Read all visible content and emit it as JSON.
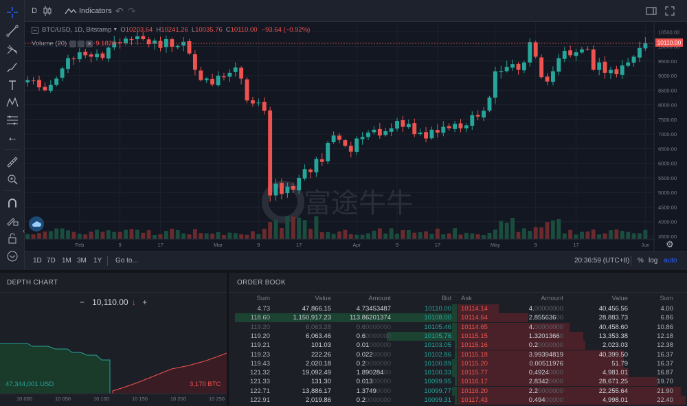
{
  "toolbar": {
    "interval": "D",
    "indicators_label": "Indicators"
  },
  "legend": {
    "symbol": "BTC/USD, 1D, Bitstamp",
    "open_label": "O",
    "open": "10203.64",
    "high_label": "H",
    "high": "10241.26",
    "low_label": "L",
    "low": "10035.76",
    "close_label": "C",
    "close": "10110.00",
    "change": "−93.64 (−0.92%)",
    "volume_label": "Volume (20)",
    "volume_value": "9.182K"
  },
  "chart_data": {
    "type": "candlestick",
    "symbol": "BTC/USD",
    "interval": "1D",
    "exchange": "Bitstamp",
    "last_price": 10110.0,
    "price_axis": [
      "10500.00",
      "10000.00",
      "9500.00",
      "9000.00",
      "8500.00",
      "8000.00",
      "7500.00",
      "7000.00",
      "6500.00",
      "6000.00",
      "5500.00",
      "5000.00",
      "4500.00",
      "4000.00",
      "3500.00"
    ],
    "ylim": [
      3500,
      10650
    ],
    "time_axis": [
      {
        "label": "Feb",
        "index": 9
      },
      {
        "label": "9",
        "index": 16
      },
      {
        "label": "17",
        "index": 23
      },
      {
        "label": "Mar",
        "index": 33
      },
      {
        "label": "9",
        "index": 40
      },
      {
        "label": "17",
        "index": 47
      },
      {
        "label": "Apr",
        "index": 57
      },
      {
        "label": "9",
        "index": 64
      },
      {
        "label": "17",
        "index": 71
      },
      {
        "label": "May",
        "index": 81
      },
      {
        "label": "9",
        "index": 88
      },
      {
        "label": "17",
        "index": 95
      },
      {
        "label": "Jun",
        "index": 107
      }
    ],
    "close_series": [
      8850,
      8830,
      8600,
      8500,
      8680,
      8900,
      9250,
      9600,
      9580,
      9800,
      9700,
      9650,
      9750,
      9610,
      9960,
      10150,
      10120,
      10270,
      10220,
      10350,
      10250,
      10080,
      10200,
      9950,
      10250,
      9990,
      10020,
      10160,
      9760,
      9200,
      8850,
      8900,
      8700,
      9000,
      8950,
      9100,
      9280,
      8900,
      8150,
      8050,
      8080,
      7800,
      4900,
      5300,
      4950,
      5200,
      5100,
      5500,
      5800,
      5700,
      6150,
      6050,
      6700,
      6950,
      6800,
      6600,
      6400,
      6850,
      6900,
      7050,
      7150,
      6950,
      7100,
      7200,
      7450,
      7250,
      7350,
      7000,
      7050,
      6850,
      7150,
      7050,
      7250,
      7200,
      7350,
      7200,
      7300,
      7650,
      7600,
      7800,
      8250,
      9150,
      9150,
      9300,
      9400,
      9200,
      9450,
      10150,
      9650,
      8950,
      8800,
      9150,
      9600,
      9850,
      9700,
      9800,
      9900,
      9900,
      9200,
      9450,
      9100,
      9200,
      9050,
      9350,
      9450,
      9650,
      9950,
      10110
    ],
    "volume_max": 1
  },
  "tabs_bottom": [
    "1D",
    "7D",
    "1M",
    "3M",
    "1Y"
  ],
  "goto_label": "Go to...",
  "time_display": "20:36:59 (UTC+8)",
  "pct_label": "%",
  "log_label": "log",
  "auto_label": "auto",
  "watermark_text": "富途牛牛",
  "depth": {
    "title": "DEPTH CHART",
    "price": "10,110.00",
    "minus": "−",
    "plus": "+",
    "bid_volume": "47,344,001 USD",
    "ask_volume": "3,170 BTC",
    "x_ticks": [
      "10 000",
      "10 050",
      "10 100",
      "10 150",
      "10 200",
      "10 250"
    ]
  },
  "orderbook": {
    "title": "ORDER BOOK",
    "headers": {
      "sum": "Sum",
      "value": "Value",
      "amount": "Amount",
      "bid": "Bid",
      "ask": "Ask",
      "amount2": "Amount",
      "value2": "Value",
      "sum2": "Sum"
    },
    "rows": [
      {
        "bsum": "4.73",
        "bval": "47,866.15",
        "bamt": "4.73453487",
        "bamt_pad": "",
        "bid": "10110.00",
        "ask": "10114.14",
        "aamt": "4.",
        "aamt_pad": "00000000",
        "aval": "40,456.56",
        "asum": "4.00"
      },
      {
        "bsum": "118.60",
        "bval": "1,150,917.23",
        "bamt": "113.86201374",
        "bamt_pad": "",
        "bid": "10108.00",
        "ask": "10114.64",
        "aamt": "2.855636",
        "aamt_pad": "00",
        "aval": "28,883.73",
        "asum": "6.86"
      },
      {
        "bsum": "119.20",
        "bval": "6,063.28",
        "bamt": "0.6",
        "bamt_pad": "0000000",
        "bid": "10105.46",
        "ask": "10114.65",
        "aamt": "4.",
        "aamt_pad": "00000000",
        "aval": "40,458.60",
        "asum": "10.86"
      },
      {
        "bsum": "119.20",
        "bval": "6,063.46",
        "bamt": "0.6",
        "bamt_pad": "0000000",
        "bid": "10105.76",
        "ask": "10115.15",
        "aamt": "1.3201366",
        "aamt_pad": "0",
        "aval": "13,353.38",
        "asum": "12.18"
      },
      {
        "bsum": "119.21",
        "bval": "101.03",
        "bamt": "0.01",
        "bamt_pad": "000000",
        "bid": "10103.05",
        "ask": "10115.16",
        "aamt": "0.2",
        "aamt_pad": "0000000",
        "aval": "2,023.03",
        "asum": "12.38"
      },
      {
        "bsum": "119.23",
        "bval": "222.26",
        "bamt": "0.022",
        "bamt_pad": "00000",
        "bid": "10102.86",
        "ask": "10115.18",
        "aamt": "3.99394819",
        "aamt_pad": "",
        "aval": "40,399.50",
        "asum": "16.37"
      },
      {
        "bsum": "119.43",
        "bval": "2,020.18",
        "bamt": "0.2",
        "bamt_pad": "0000000",
        "bid": "10100.89",
        "ask": "10115.20",
        "aamt": "0.00511976",
        "aamt_pad": "",
        "aval": "51.79",
        "asum": "16.37"
      },
      {
        "bsum": "121.32",
        "bval": "19,092.49",
        "bamt": "1.890284",
        "bamt_pad": "00",
        "bid": "10100.33",
        "ask": "10115.77",
        "aamt": "0.4924",
        "aamt_pad": "0000",
        "aval": "4,981.01",
        "asum": "16.87"
      },
      {
        "bsum": "121.33",
        "bval": "131.30",
        "bamt": "0.013",
        "bamt_pad": "00000",
        "bid": "10099.95",
        "ask": "10116.17",
        "aamt": "2.8342",
        "aamt_pad": "0000",
        "aval": "28,671.25",
        "asum": "19.70"
      },
      {
        "bsum": "122.71",
        "bval": "13,886.17",
        "bamt": "1.3749",
        "bamt_pad": "0000",
        "bid": "10099.77",
        "ask": "10116.20",
        "aamt": "2.2",
        "aamt_pad": "0000000",
        "aval": "22,255.64",
        "asum": "21.90"
      },
      {
        "bsum": "122.91",
        "bval": "2,019.86",
        "bamt": "0.2",
        "bamt_pad": "0000000",
        "bid": "10099.31",
        "ask": "10117.43",
        "aamt": "0.494",
        "aamt_pad": "00000",
        "aval": "4,998.01",
        "asum": "22.40"
      }
    ],
    "bid_depth": [
      0.02,
      0.98,
      0.02,
      0.31,
      0.01,
      0.01,
      0.02,
      0.02,
      0.01,
      0.02,
      0.01
    ],
    "ask_depth": [
      0.18,
      0.31,
      0.49,
      0.55,
      0.56,
      0.73,
      0.73,
      0.75,
      0.88,
      0.98,
      1.0
    ]
  },
  "colors": {
    "up": "#26a69a",
    "down": "#ef5350",
    "bg": "#131722",
    "panel": "#1c1f26",
    "accent": "#2962ff"
  }
}
